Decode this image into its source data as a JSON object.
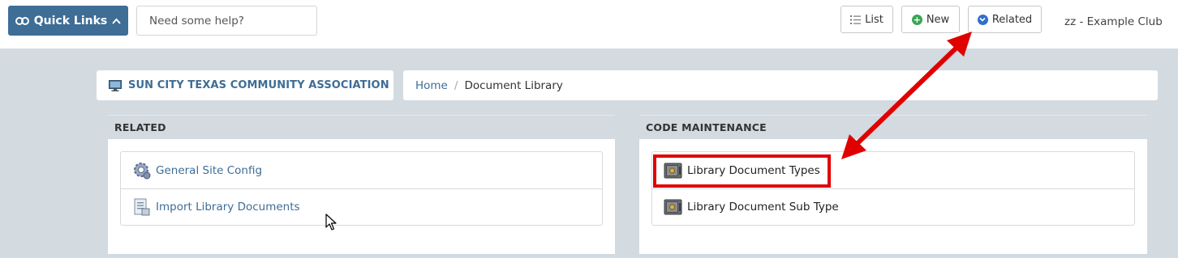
{
  "topbar": {
    "quick_links_label": "Quick Links",
    "help_placeholder": "Need some help?",
    "list_label": "List",
    "new_label": "New",
    "related_label": "Related",
    "club_name": "zz - Example Club"
  },
  "breadcrumb": {
    "org_name": "SUN CITY TEXAS COMMUNITY ASSOCIATION",
    "home": "Home",
    "separator": "/",
    "current": "Document Library"
  },
  "related_panel": {
    "title": "RELATED",
    "items": [
      {
        "label": "General Site Config",
        "icon": "gear-icon"
      },
      {
        "label": "Import Library Documents",
        "icon": "import-document-icon"
      }
    ]
  },
  "code_panel": {
    "title": "CODE MAINTENANCE",
    "items": [
      {
        "label": "Library Document Types",
        "icon": "safe-icon"
      },
      {
        "label": "Library Document Sub Type",
        "icon": "safe-icon"
      }
    ]
  },
  "colors": {
    "brand": "#3e6d96",
    "annotation": "#e00000",
    "background": "#d3dae0"
  }
}
